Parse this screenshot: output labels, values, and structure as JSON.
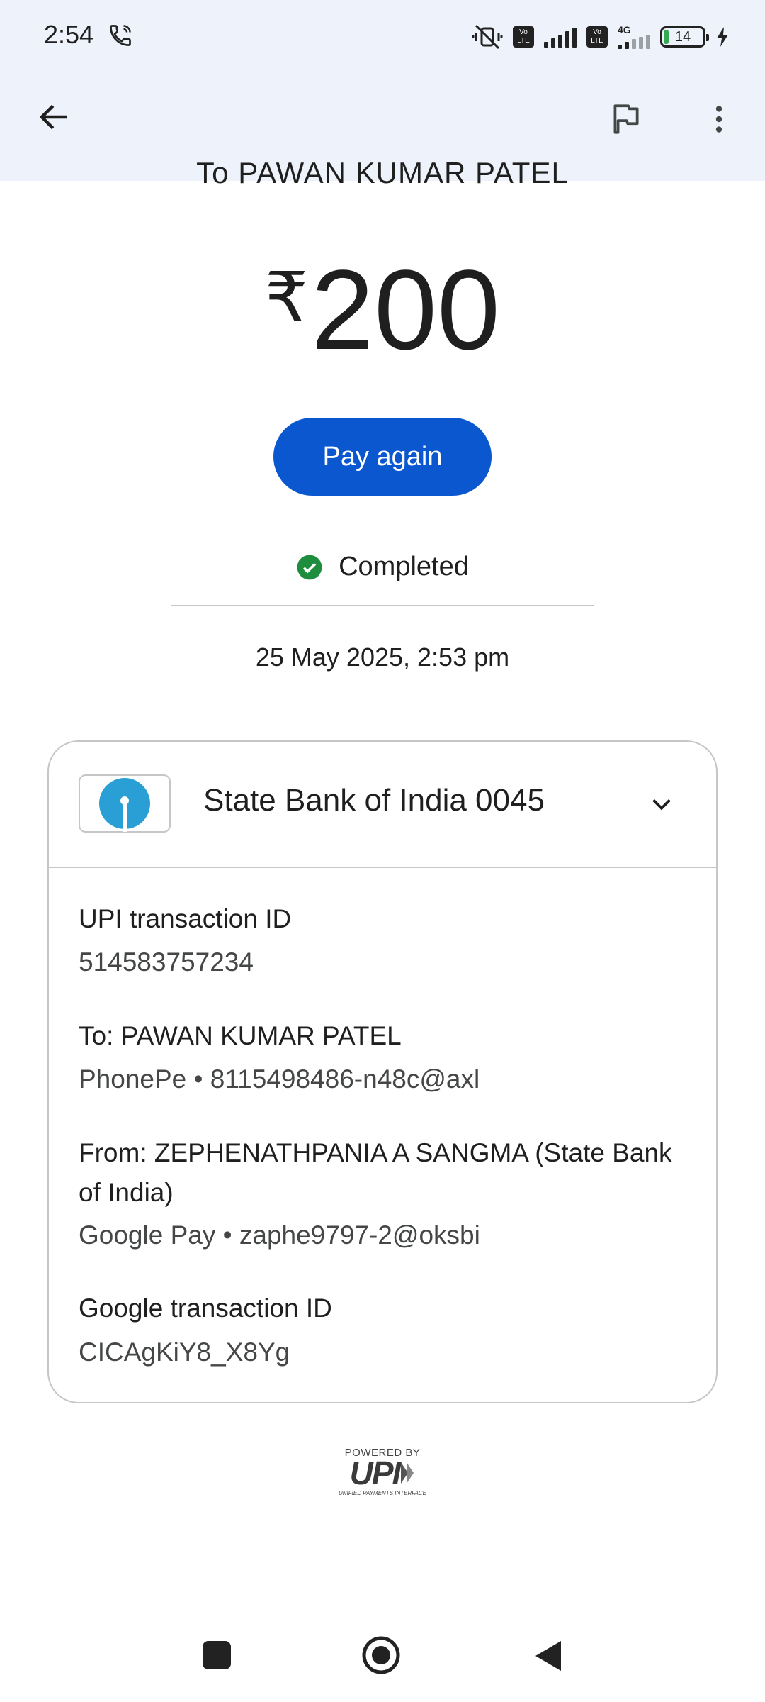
{
  "status_bar": {
    "time": "2:54",
    "volte_1": "Vo LTE",
    "volte_2": "Vo LTE",
    "network": "4G",
    "battery": "14"
  },
  "header": {
    "back_icon": "arrow-left-icon",
    "flag_icon": "flag-icon",
    "more_icon": "more-vert-icon"
  },
  "transaction": {
    "to_line": "To PAWAN KUMAR PATEL",
    "currency": "₹",
    "amount": "200",
    "pay_again_label": "Pay again",
    "status": "Completed",
    "status_color": "#1e8e3e",
    "datetime": "25 May 2025, 2:53 pm"
  },
  "card": {
    "bank_name": "State Bank of India 0045",
    "details": [
      {
        "label": "UPI transaction ID",
        "value": "514583757234"
      },
      {
        "label": "To: PAWAN KUMAR PATEL",
        "value": "PhonePe • 8115498486-n48c@axl"
      },
      {
        "label": "From: ZEPHENATHPANIA A SANGMA (State Bank of India)",
        "value": "Google Pay • zaphe9797-2@oksbi"
      },
      {
        "label": "Google transaction ID",
        "value": "CICAgKiY8_X8Yg"
      }
    ]
  },
  "footer": {
    "powered_by": "POWERED BY",
    "upi": "UPI",
    "upi_sub": "UNIFIED PAYMENTS INTERFACE"
  },
  "colors": {
    "accent": "#0b57d0",
    "header_bg": "#eef2fa",
    "sbi_blue": "#2a9fd6"
  }
}
